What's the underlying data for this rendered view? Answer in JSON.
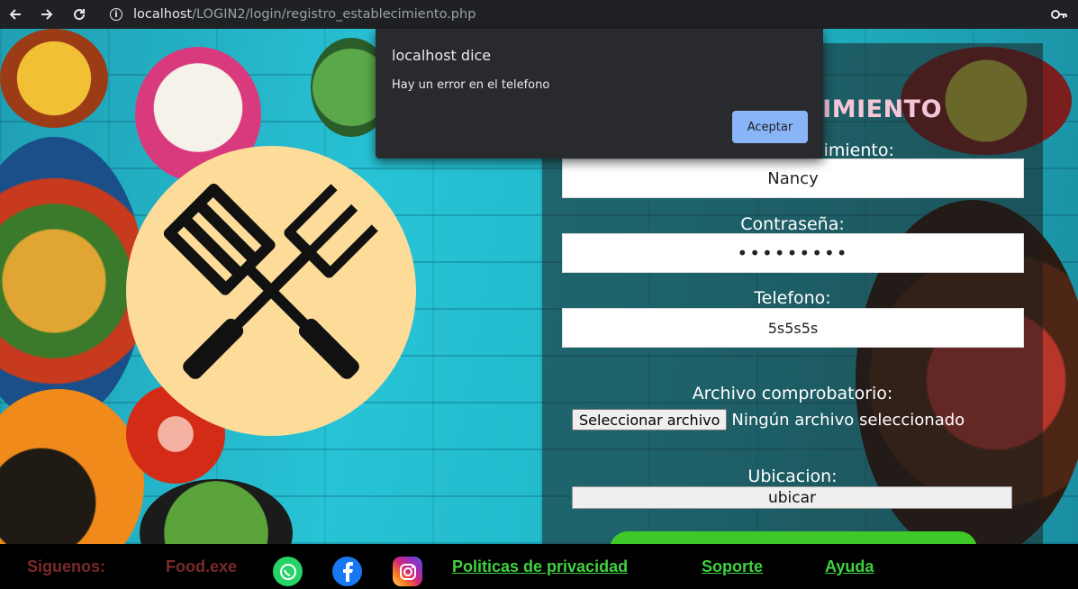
{
  "browser": {
    "url_host": "localhost",
    "url_path": "/LOGIN2/login/registro_establecimiento.php"
  },
  "form": {
    "title": "ECIMIENTO",
    "name_label": "lecimiento:",
    "name_value": "Nancy",
    "password_label": "Contraseña:",
    "password_value": "•••••••••",
    "phone_label": "Telefono:",
    "phone_value": "5s5s5s",
    "file_label": "Archivo comprobatorio:",
    "file_button": "Seleccionar archivo",
    "file_status": "Ningún archivo seleccionado",
    "location_label": "Ubicacion:",
    "locate_button": "ubicar"
  },
  "footer": {
    "follow": "Siguenos:",
    "brand": "Food.exe",
    "links": [
      "Politicas de privacidad",
      "Soporte",
      "Ayuda"
    ]
  },
  "dialog": {
    "title": "localhost dice",
    "message": "Hay un error en el telefono",
    "accept": "Aceptar"
  },
  "colors": {
    "title": "#f5c6d8",
    "link": "#3fd13f",
    "dialog_button": "#8ab4f8"
  }
}
